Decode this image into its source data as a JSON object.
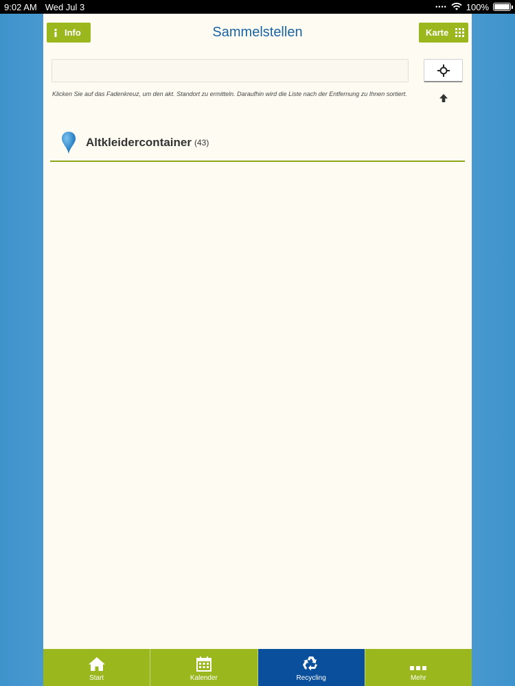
{
  "status_bar": {
    "time": "9:02 AM",
    "date": "Wed Jul 3",
    "battery": "100%"
  },
  "header": {
    "title": "Sammelstellen",
    "info_label": "Info",
    "karte_label": "Karte"
  },
  "search": {
    "value": "",
    "placeholder": ""
  },
  "hint": "Klicken Sie auf das Fadenkreuz, um den akt. Standort zu ermitteln. Daraufhin wird die Liste nach der Entfernung zu Ihnen sortiert.",
  "categories": [
    {
      "label": "Altkleidercontainer",
      "count": "(43)",
      "icon": "map-pin-icon"
    }
  ],
  "tabs": [
    {
      "label": "Start",
      "icon": "home-icon"
    },
    {
      "label": "Kalender",
      "icon": "calendar-icon"
    },
    {
      "label": "Recycling",
      "icon": "recycle-icon",
      "active": true
    },
    {
      "label": "Mehr",
      "icon": "more-icon"
    }
  ],
  "colors": {
    "brand_green": "#9ab81e",
    "active_blue": "#0a4f9c",
    "title_blue": "#1a63a3",
    "panel_bg": "#fdfbf2"
  }
}
